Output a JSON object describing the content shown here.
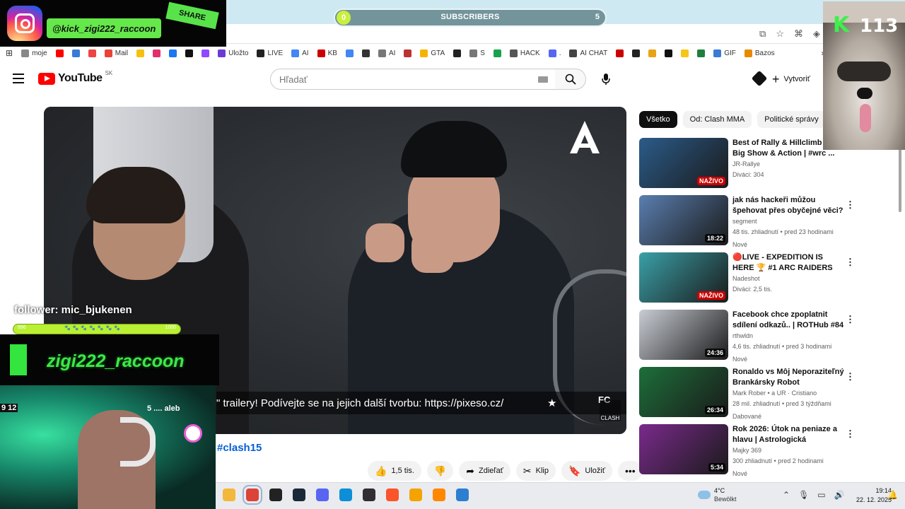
{
  "browser": {
    "bookmarks": [
      {
        "label": "moje",
        "color": "#888888"
      },
      {
        "label": "",
        "color": "#ff0000"
      },
      {
        "label": "",
        "color": "#3a7bd5"
      },
      {
        "label": "",
        "color": "#e44"
      },
      {
        "label": "Mail",
        "color": "#ea4335"
      },
      {
        "label": "",
        "color": "#f4c20d"
      },
      {
        "label": "",
        "color": "#e1306c"
      },
      {
        "label": "",
        "color": "#1877f2"
      },
      {
        "label": "",
        "color": "#111111"
      },
      {
        "label": "",
        "color": "#9146ff"
      },
      {
        "label": "Uložto",
        "color": "#6c3bd5"
      },
      {
        "label": "LIVE",
        "color": "#222222"
      },
      {
        "label": "AI",
        "color": "#4285f4"
      },
      {
        "label": "KB",
        "color": "#cc0000"
      },
      {
        "label": "",
        "color": "#4285f4"
      },
      {
        "label": "",
        "color": "#333333"
      },
      {
        "label": "AI",
        "color": "#777777"
      },
      {
        "label": "",
        "color": "#b33"
      },
      {
        "label": "GTA",
        "color": "#f4b400"
      },
      {
        "label": "",
        "color": "#222222"
      },
      {
        "label": "S",
        "color": "#777777"
      },
      {
        "label": "",
        "color": "#16a34a"
      },
      {
        "label": "HACK",
        "color": "#555555"
      },
      {
        "label": ".",
        "color": "#5865f2"
      },
      {
        "label": "AI CHAT",
        "color": "#444444"
      },
      {
        "label": "",
        "color": "#cc0000"
      },
      {
        "label": "",
        "color": "#222222"
      },
      {
        "label": "",
        "color": "#e8a317"
      },
      {
        "label": "",
        "color": "#111111"
      },
      {
        "label": "",
        "color": "#f5c518"
      },
      {
        "label": "",
        "color": "#1e7f3e"
      },
      {
        "label": "GIF",
        "color": "#3a7bd5"
      },
      {
        "label": "Bazos",
        "color": "#e68a00"
      }
    ],
    "bookmarks_more": "»"
  },
  "youtube": {
    "logo_text": "YouTube",
    "country_code": "SK",
    "search_placeholder": "Hľadať",
    "create_label": "Vytvoriť"
  },
  "video": {
    "ticker_text": "\" trailery! Podívejte se na jejich další tvorbu: https://pixeso.cz/",
    "ticker_star": "★",
    "ticker_fc": "FC",
    "corner_label": "CLASH",
    "hashtag": "#clash15",
    "actions": [
      {
        "label": "1,5 tis.",
        "icon": "thumbs-up-icon",
        "glyph": "👍"
      },
      {
        "label": "",
        "icon": "thumbs-down-icon",
        "glyph": "👎"
      },
      {
        "label": "Zdieľať",
        "icon": "share-icon",
        "glyph": "➦"
      },
      {
        "label": "Klip",
        "icon": "scissors-icon",
        "glyph": "✂"
      },
      {
        "label": "Uložiť",
        "icon": "save-icon",
        "glyph": "🔖"
      },
      {
        "label": "",
        "icon": "more-icon",
        "glyph": "•••"
      }
    ]
  },
  "chips": [
    "Všetko",
    "Od: Clash MMA",
    "Politické správy"
  ],
  "recommendations": [
    {
      "title": "Best of Rally & Hillclimb 2025 Big Show & Action | #wrc ...",
      "channel": "JR-Rallye",
      "verified": false,
      "stats": "Diváci: 304",
      "tag": "",
      "badge": "NAŽIVO",
      "live": true,
      "thumb_color": "#2b5c8a",
      "kebab": false
    },
    {
      "title": "jak nás hackeři můžou špehovat přes obyčejné věci?",
      "channel": "segment",
      "verified": true,
      "stats": "48 tis. zhliadnutí • pred 23 hodinami",
      "tag": "Nové",
      "badge": "18:22",
      "live": false,
      "thumb_color": "#5a7fb0",
      "kebab": true
    },
    {
      "title": "🔴LIVE - EXPEDITION IS HERE 🏆 #1 ARC RAIDERS GRIND ...",
      "channel": "Nadeshot",
      "verified": true,
      "stats": "Diváci: 2,5 tis.",
      "tag": "",
      "badge": "NAŽIVO",
      "live": true,
      "thumb_color": "#3aa0a8",
      "kebab": true
    },
    {
      "title": "Facebook chce zpoplatnit sdílení odkazů.. | ROTHub #84",
      "channel": "rthwldn",
      "verified": true,
      "stats": "4,6 tis. zhliadnutí • pred 3 hodinami",
      "tag": "Nové",
      "badge": "24:36",
      "live": false,
      "thumb_color": "#c9cdd4",
      "kebab": true
    },
    {
      "title": "Ronaldo vs Môj Neporaziteľný Brankársky Robot",
      "channel": "Mark Rober • a UR · Cristiano",
      "verified": true,
      "stats": "28 mil. zhliadnutí • pred 3 týždňami",
      "tag": "Dabované",
      "badge": "26:34",
      "live": false,
      "thumb_color": "#1d6f3a",
      "kebab": true
    },
    {
      "title": "Rok 2026: Útok na peniaze a hlavu | Astrologická predpove...",
      "channel": "Majky 369",
      "verified": false,
      "stats": "300 zhliadnutí • pred 2 hodinami",
      "tag": "Nové",
      "badge": "5:34",
      "live": false,
      "thumb_color": "#7a2a8c",
      "kebab": true
    }
  ],
  "overlays": {
    "handle": "@kick_zigi222_raccoon",
    "share_label": "SHARE",
    "subscribers_label": "SUBSCRIBERS",
    "subscribers_current": "0",
    "subscribers_goal": "5",
    "subscribers_progress": 0,
    "k_letter": "K",
    "k_number": "113",
    "follower_text": "follower: mic_bjukenen",
    "follow_bar_left": "996",
    "follow_bar_right": "1000",
    "follow_bar_progress": 0.996,
    "follow_bar_paws": "🐾🐾🐾🐾🐾🐾🐾",
    "streamer_name": "zigi222_raccoon",
    "webcam_text": "5 .... aleb",
    "webcam_clock": "9 12"
  },
  "taskbar": {
    "apps": [
      {
        "name": "file-explorer-icon",
        "color": "#f3b73b"
      },
      {
        "name": "chrome-icon",
        "color": "#db4437",
        "active": true
      },
      {
        "name": "epic-games-icon",
        "color": "#222222"
      },
      {
        "name": "steam-icon",
        "color": "#1b2838"
      },
      {
        "name": "discord-icon",
        "color": "#5865f2"
      },
      {
        "name": "edge-icon",
        "color": "#0c8fd6"
      },
      {
        "name": "obs-icon",
        "color": "#302e31"
      },
      {
        "name": "brave-icon",
        "color": "#fb542b"
      },
      {
        "name": "app-icon",
        "color": "#f4a300"
      },
      {
        "name": "vlc-icon",
        "color": "#ff8800"
      },
      {
        "name": "window-icon",
        "color": "#2c7fd0"
      }
    ],
    "weather_temp": "4°C",
    "weather_desc": "Bewölkt",
    "time": "19:14",
    "date": "22. 12. 2025"
  }
}
